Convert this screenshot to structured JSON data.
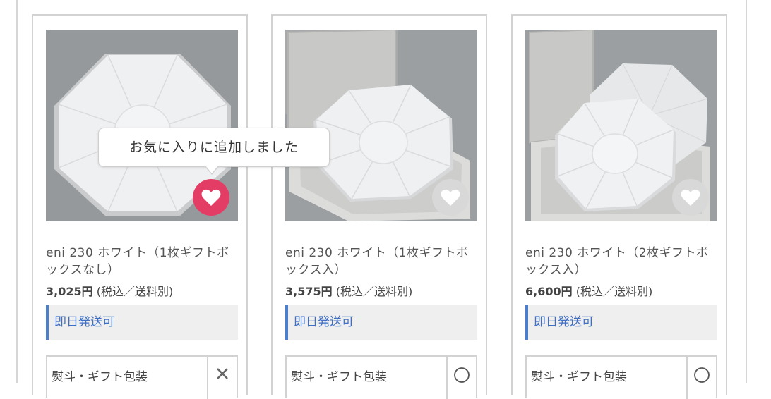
{
  "products": [
    {
      "title": "eni 230 ホワイト（1枚ギフトボックスなし）",
      "price": "3,025円",
      "tax_note": "(税込／送料別)",
      "stock_label": "即日発送可",
      "gift_label": "熨斗・ギフト包装",
      "gift_mark": "✕",
      "favorited": true
    },
    {
      "title": "eni 230 ホワイト（1枚ギフトボックス入）",
      "price": "3,575円",
      "tax_note": "(税込／送料別)",
      "stock_label": "即日発送可",
      "gift_label": "熨斗・ギフト包装",
      "gift_mark": "◯",
      "favorited": false
    },
    {
      "title": "eni 230 ホワイト（2枚ギフトボックス入）",
      "price": "6,600円",
      "tax_note": "(税込／送料別)",
      "stock_label": "即日発送可",
      "gift_label": "熨斗・ギフト包装",
      "gift_mark": "◯",
      "favorited": false
    }
  ],
  "tooltip": {
    "text": "お気に入りに追加しました"
  },
  "colors": {
    "favorite_active": "#e33d66",
    "favorite_inactive": "#d8d8d8",
    "stock_accent": "#4a7fd0",
    "stock_text": "#3e6fc4"
  }
}
